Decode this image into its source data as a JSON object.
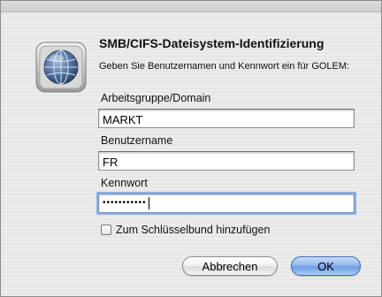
{
  "dialog": {
    "title": "SMB/CIFS-Dateisystem-Identifizierung",
    "message": "Geben Sie Benutzernamen und Kennwort ein für GOLEM:",
    "icon": "network-globe-icon"
  },
  "fields": {
    "workgroup": {
      "label": "Arbeitsgruppe/Domain",
      "value": "MARKT"
    },
    "username": {
      "label": "Benutzername",
      "value": "FR"
    },
    "password": {
      "label": "Kennwort",
      "masked": "•••••••••••"
    }
  },
  "checkbox": {
    "label": "Zum Schlüsselbund hinzufügen",
    "checked": false
  },
  "buttons": {
    "cancel": "Abbrechen",
    "ok": "OK"
  },
  "colors": {
    "default_button": "#6c9ee3",
    "focus_ring": "#8fb0e5"
  }
}
